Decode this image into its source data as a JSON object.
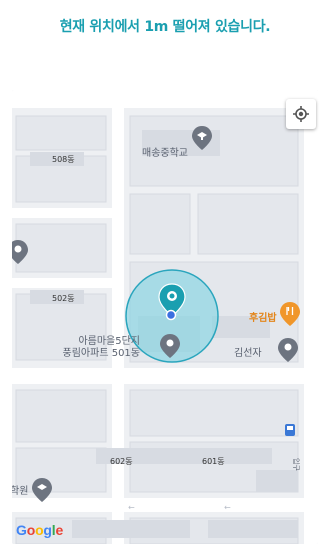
{
  "header": {
    "message": "현재 위치에서 1m 떨어져 있습니다."
  },
  "map": {
    "labels": {
      "school": "매송중학교",
      "bldg_508": "508동",
      "bldg_502": "502동",
      "apt_line1": "아름마을5단지",
      "apt_line2": "풍림아파트 501동",
      "restaurant": "후김밥",
      "person_place": "김선자",
      "bldg_602": "602동",
      "bldg_601": "601동",
      "academy": "학원",
      "bus_stop": "입구"
    },
    "colors": {
      "accent": "#1a9fb0",
      "pin_gray": "#6d7480",
      "restaurant_orange": "#f0962a"
    },
    "location_button_icon": "my-location-icon"
  },
  "attribution": {
    "g": "G",
    "o1": "o",
    "o2": "o",
    "g2": "g",
    "l": "l",
    "e": "e"
  }
}
